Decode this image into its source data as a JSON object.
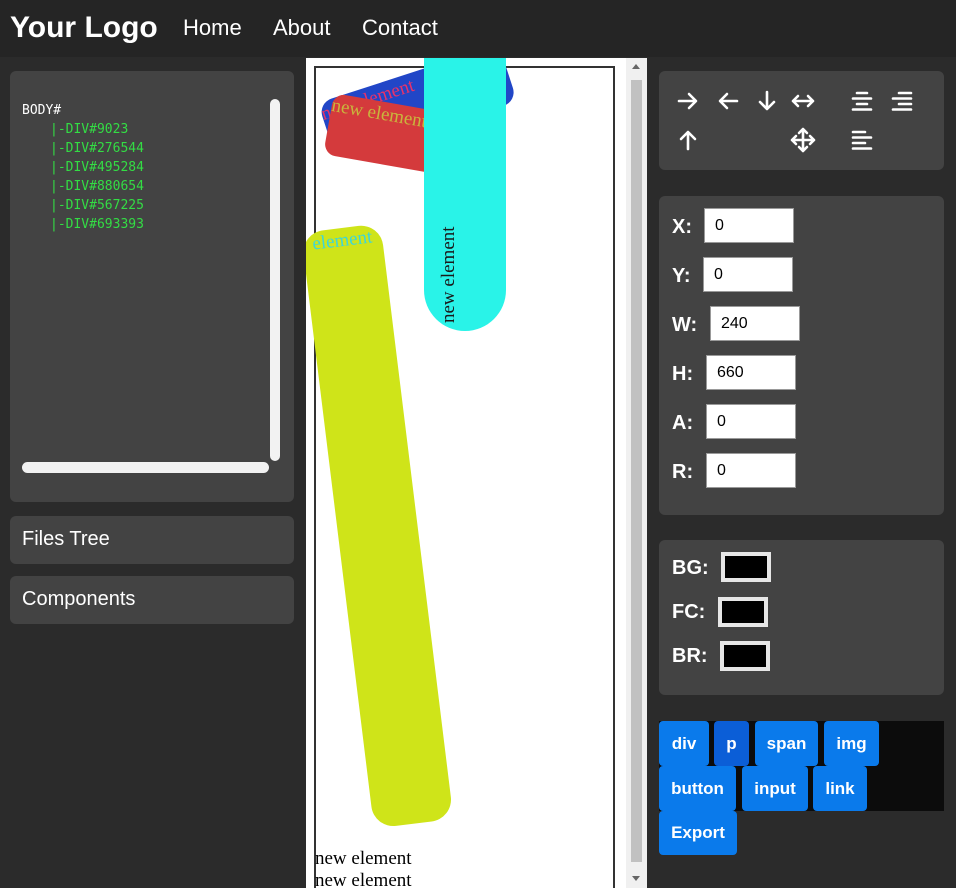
{
  "header": {
    "logo": "Your Logo",
    "nav": [
      "Home",
      "About",
      "Contact"
    ]
  },
  "dom_tree": {
    "root": "BODY#",
    "items": [
      "|-DIV#9023",
      "|-DIV#276544",
      "|-DIV#495284",
      "|-DIV#880654",
      "|-DIV#567225",
      "|-DIV#693393"
    ]
  },
  "sidebar": {
    "files_tree": "Files Tree",
    "components": "Components"
  },
  "canvas": {
    "elements": [
      {
        "text": "new element",
        "bg": "#2146c7",
        "color": "#e8326a"
      },
      {
        "text": "new element",
        "bg": "#d43a3c",
        "color": "#c9b53c"
      },
      {
        "text": "new element",
        "bg": "#29f3e8",
        "color": "#1a1a1a"
      },
      {
        "text": "element",
        "bg": "#cfe419",
        "color": "#3fd6d6"
      },
      {
        "text": "new element",
        "bg": "transparent",
        "color": "#000000"
      },
      {
        "text": "new element",
        "bg": "transparent",
        "color": "#000000"
      }
    ]
  },
  "tools": {
    "icons": [
      "arrow-right-icon",
      "arrow-left-icon",
      "arrow-down-icon",
      "arrows-horizontal-icon",
      "align-center-icon",
      "align-right-icon",
      "arrow-up-icon",
      "move-icon",
      "align-left-icon"
    ]
  },
  "properties": {
    "x": {
      "label": "X:",
      "value": "0"
    },
    "y": {
      "label": "Y:",
      "value": "0"
    },
    "w": {
      "label": "W:",
      "value": "240"
    },
    "h": {
      "label": "H:",
      "value": "660"
    },
    "a": {
      "label": "A:",
      "value": "0"
    },
    "r": {
      "label": "R:",
      "value": "0"
    }
  },
  "colors": {
    "bg": {
      "label": "BG:",
      "value": "#000000"
    },
    "fc": {
      "label": "FC:",
      "value": "#000000"
    },
    "br": {
      "label": "BR:",
      "value": "#000000"
    }
  },
  "element_buttons": [
    "div",
    "p",
    "span",
    "img",
    "button",
    "input",
    "link",
    "Export"
  ],
  "theme": {
    "accent": "#0a7aeb",
    "panel": "#434343",
    "background": "#2b2b2b"
  }
}
